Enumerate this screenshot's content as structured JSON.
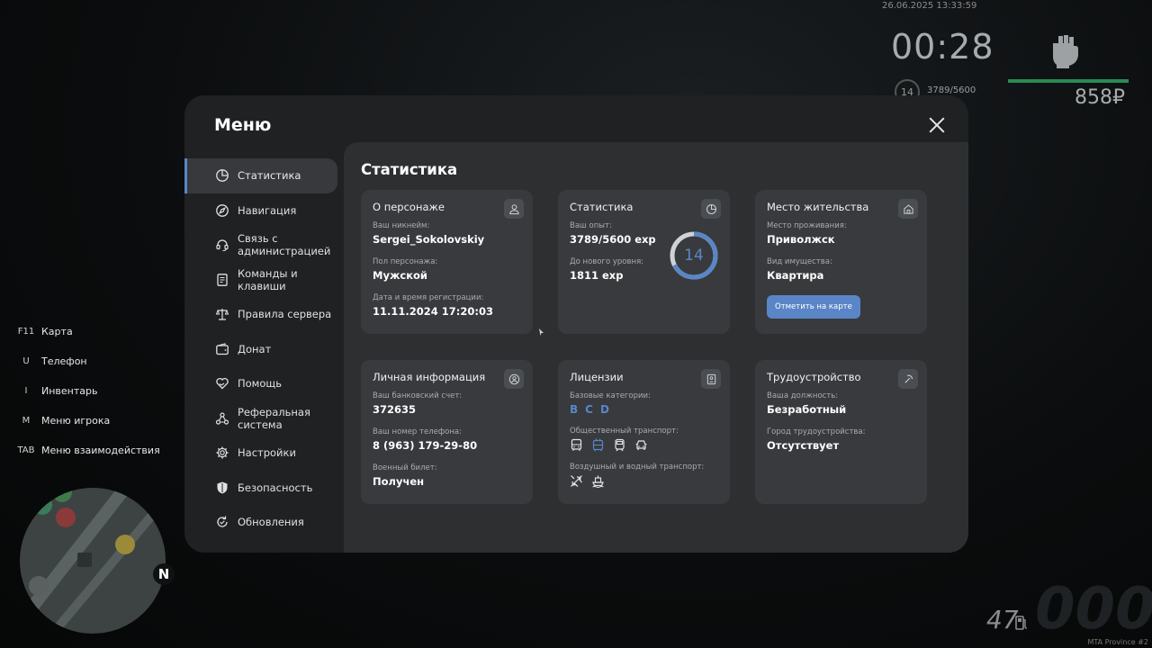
{
  "hud": {
    "datetime": "26.06.2025 13:33:59",
    "timer": "00:28",
    "level": "14",
    "exp": "3789/5600",
    "money": "858₽",
    "fuel": "47",
    "watermark": "MTA Province #2"
  },
  "hotkeys": [
    {
      "key": "F11",
      "action": "Карта"
    },
    {
      "key": "U",
      "action": "Телефон"
    },
    {
      "key": "I",
      "action": "Инвентарь"
    },
    {
      "key": "M",
      "action": "Меню игрока"
    },
    {
      "key": "TAB",
      "action": "Меню взаимодействия"
    }
  ],
  "minimap": {
    "north": "N"
  },
  "modal": {
    "title": "Меню",
    "sidebar": [
      {
        "label": "Статистика",
        "icon": "pie-chart-icon"
      },
      {
        "label": "Навигация",
        "icon": "compass-icon"
      },
      {
        "label": "Связь с администрацией",
        "icon": "headset-icon"
      },
      {
        "label": "Команды и клавиши",
        "icon": "document-icon"
      },
      {
        "label": "Правила сервера",
        "icon": "scales-icon"
      },
      {
        "label": "Донат",
        "icon": "wallet-icon"
      },
      {
        "label": "Помощь",
        "icon": "heart-hand-icon"
      },
      {
        "label": "Реферальная система",
        "icon": "network-icon"
      },
      {
        "label": "Настройки",
        "icon": "gear-icon"
      },
      {
        "label": "Безопасность",
        "icon": "shield-icon"
      },
      {
        "label": "Обновления",
        "icon": "refresh-icon"
      }
    ],
    "content_title": "Статистика",
    "cards": {
      "character": {
        "title": "О персонаже",
        "icon": "user-icon",
        "fields": [
          {
            "label": "Ваш никнейм:",
            "value": "Sergei_Sokolovskiy"
          },
          {
            "label": "Пол персонажа:",
            "value": "Мужской"
          },
          {
            "label": "Дата и время регистрации:",
            "value": "11.11.2024 17:20:03"
          }
        ]
      },
      "stats": {
        "title": "Статистика",
        "icon": "pie-chart-icon",
        "fields": [
          {
            "label": "Ваш опыт:",
            "value": "3789/5600 exp"
          },
          {
            "label": "До нового уровня:",
            "value": "1811 exp"
          }
        ],
        "level": "14",
        "progress": 0.677
      },
      "residence": {
        "title": "Место жительства",
        "icon": "home-icon",
        "fields": [
          {
            "label": "Место проживания:",
            "value": "Приволжск"
          },
          {
            "label": "Вид имущества:",
            "value": "Квартира"
          }
        ],
        "button": "Отметить на карте"
      },
      "personal": {
        "title": "Личная информация",
        "icon": "user-circle-icon",
        "fields": [
          {
            "label": "Ваш банковский счет:",
            "value": "372635"
          },
          {
            "label": "Ваш номер телефона:",
            "value": "8 (963) 179-29-80"
          },
          {
            "label": "Военный билет:",
            "value": "Получен"
          }
        ]
      },
      "licenses": {
        "title": "Лицензии",
        "icon": "id-card-icon",
        "base_label": "Базовые категории:",
        "base_categories": [
          "B",
          "C",
          "D"
        ],
        "public_label": "Общественный транспорт:",
        "air_water_label": "Воздушный и водный транспорт:"
      },
      "job": {
        "title": "Трудоустройство",
        "icon": "pickaxe-icon",
        "fields": [
          {
            "label": "Ваша должность:",
            "value": "Безработный"
          },
          {
            "label": "Город трудоустройства:",
            "value": "Отсутствует"
          }
        ]
      }
    }
  },
  "colors": {
    "accent": "#5a86c8",
    "modal_bg": "#1f2123",
    "content_bg": "#2d2f31",
    "card_bg": "#383a3d",
    "hud_green": "#2a8a55"
  }
}
